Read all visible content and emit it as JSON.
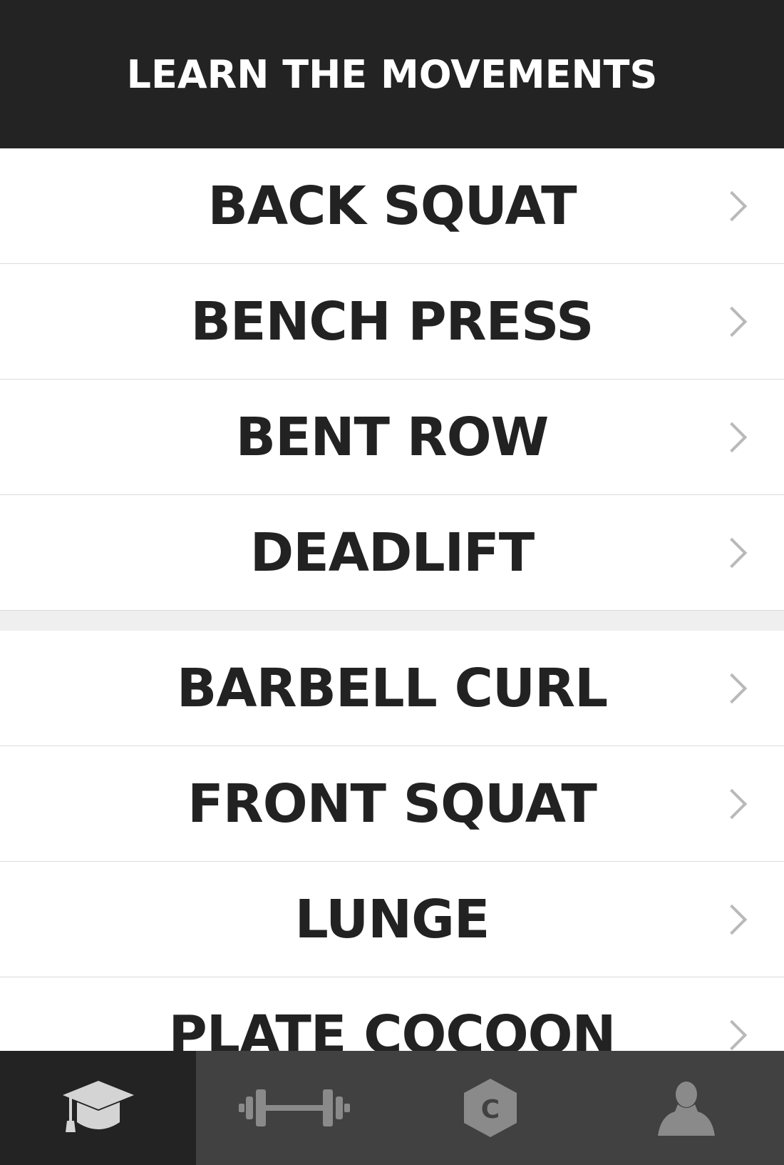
{
  "header": {
    "title": "LEARN THE MOVEMENTS"
  },
  "sections": [
    {
      "items": [
        {
          "label": "BACK SQUAT"
        },
        {
          "label": "BENCH PRESS"
        },
        {
          "label": "BENT ROW"
        },
        {
          "label": "DEADLIFT"
        }
      ]
    },
    {
      "items": [
        {
          "label": "BARBELL CURL"
        },
        {
          "label": "FRONT SQUAT"
        },
        {
          "label": "LUNGE"
        },
        {
          "label": "PLATE COCOON"
        }
      ]
    }
  ],
  "row_icon": "chevron-right-icon",
  "tabbar": {
    "tabs": [
      {
        "icon": "graduation-cap-icon",
        "active": true
      },
      {
        "icon": "barbell-icon",
        "active": false
      },
      {
        "icon": "hexagon-c-icon",
        "active": false
      },
      {
        "icon": "user-icon",
        "active": false
      }
    ]
  },
  "colors": {
    "header_bg": "#232323",
    "tabbar_bg": "#414141",
    "tab_active_bg": "#232323",
    "text": "#222222",
    "chevron": "#b9b9b9",
    "icon_active": "#d4d4d4",
    "icon_inactive": "#8a8a8a"
  }
}
